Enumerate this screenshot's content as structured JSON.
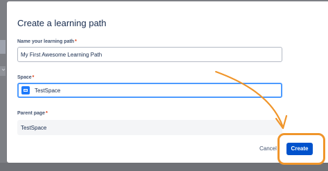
{
  "dialog": {
    "title": "Create a learning path",
    "name_field": {
      "label": "Name your learning path",
      "required_mark": "*",
      "value": "My First Awesome Learning Path"
    },
    "space_field": {
      "label": "Space",
      "required_mark": "*",
      "value": "TestSpace",
      "icon": "space-avatar-icon"
    },
    "parent_field": {
      "label": "Parent page",
      "required_mark": "*",
      "value": "TestSpace"
    },
    "buttons": {
      "cancel": "Cancel",
      "create": "Create"
    }
  },
  "annotation": {
    "color": "#f0952a"
  },
  "colors": {
    "primary": "#0052cc",
    "focus": "#4c9aff",
    "required": "#de350b"
  }
}
